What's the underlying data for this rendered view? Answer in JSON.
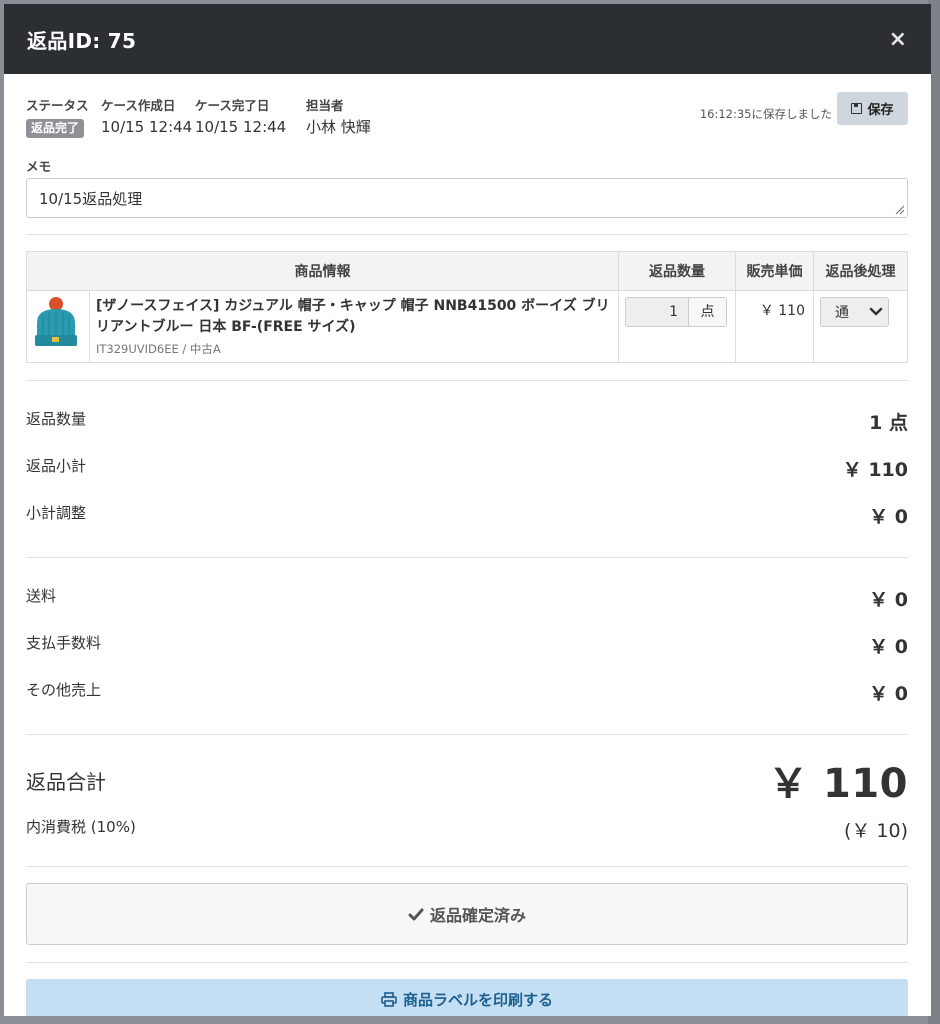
{
  "modal": {
    "title": "返品ID: 75",
    "close_label": "×"
  },
  "meta": {
    "status_label": "ステータス",
    "status_value": "返品完了",
    "created_label": "ケース作成日",
    "created_value": "10/15 12:44",
    "completed_label": "ケース完了日",
    "completed_value": "10/15 12:44",
    "assignee_label": "担当者",
    "assignee_value": "小林 快輝",
    "saved_text": "16:12:35に保存しました",
    "save_label": "保存"
  },
  "memo": {
    "label": "メモ",
    "value": "10/15返品処理"
  },
  "table": {
    "headers": [
      "商品情報",
      "返品数量",
      "販売単価",
      "返品後処理"
    ],
    "rows": [
      {
        "name": "[ザノースフェイス] カジュアル 帽子・キャップ 帽子 NNB41500 ボーイズ ブリリアントブルー 日本 BF-(FREE サイズ)",
        "code": "IT329UVID6EE / 中古A",
        "quantity": "1",
        "unit": "点",
        "price": "￥ 110",
        "disposition": "通"
      }
    ]
  },
  "summary": {
    "return_qty_label": "返品数量",
    "return_qty_value": "1 点",
    "subtotal_label": "返品小計",
    "subtotal_value": "￥ 110",
    "adjust_label": "小計調整",
    "adjust_value": "￥ 0",
    "shipping_label": "送料",
    "shipping_value": "￥ 0",
    "fee_label": "支払手数料",
    "fee_value": "￥ 0",
    "other_label": "その他売上",
    "other_value": "￥ 0",
    "total_label": "返品合計",
    "total_value": "￥ 110",
    "tax_label": "内消費税 (10%)",
    "tax_value": "(￥ 10)"
  },
  "actions": {
    "confirmed_label": "返品確定済み",
    "print_label": "商品ラベルを印刷する"
  },
  "colors": {
    "header_bg": "#2b2f33",
    "status_badge": "#8e9296",
    "print_button_bg": "#c4dff3",
    "print_button_text": "#1d5f8e",
    "hat_color": "#2a9bb0",
    "pompom_color": "#d9502a"
  }
}
